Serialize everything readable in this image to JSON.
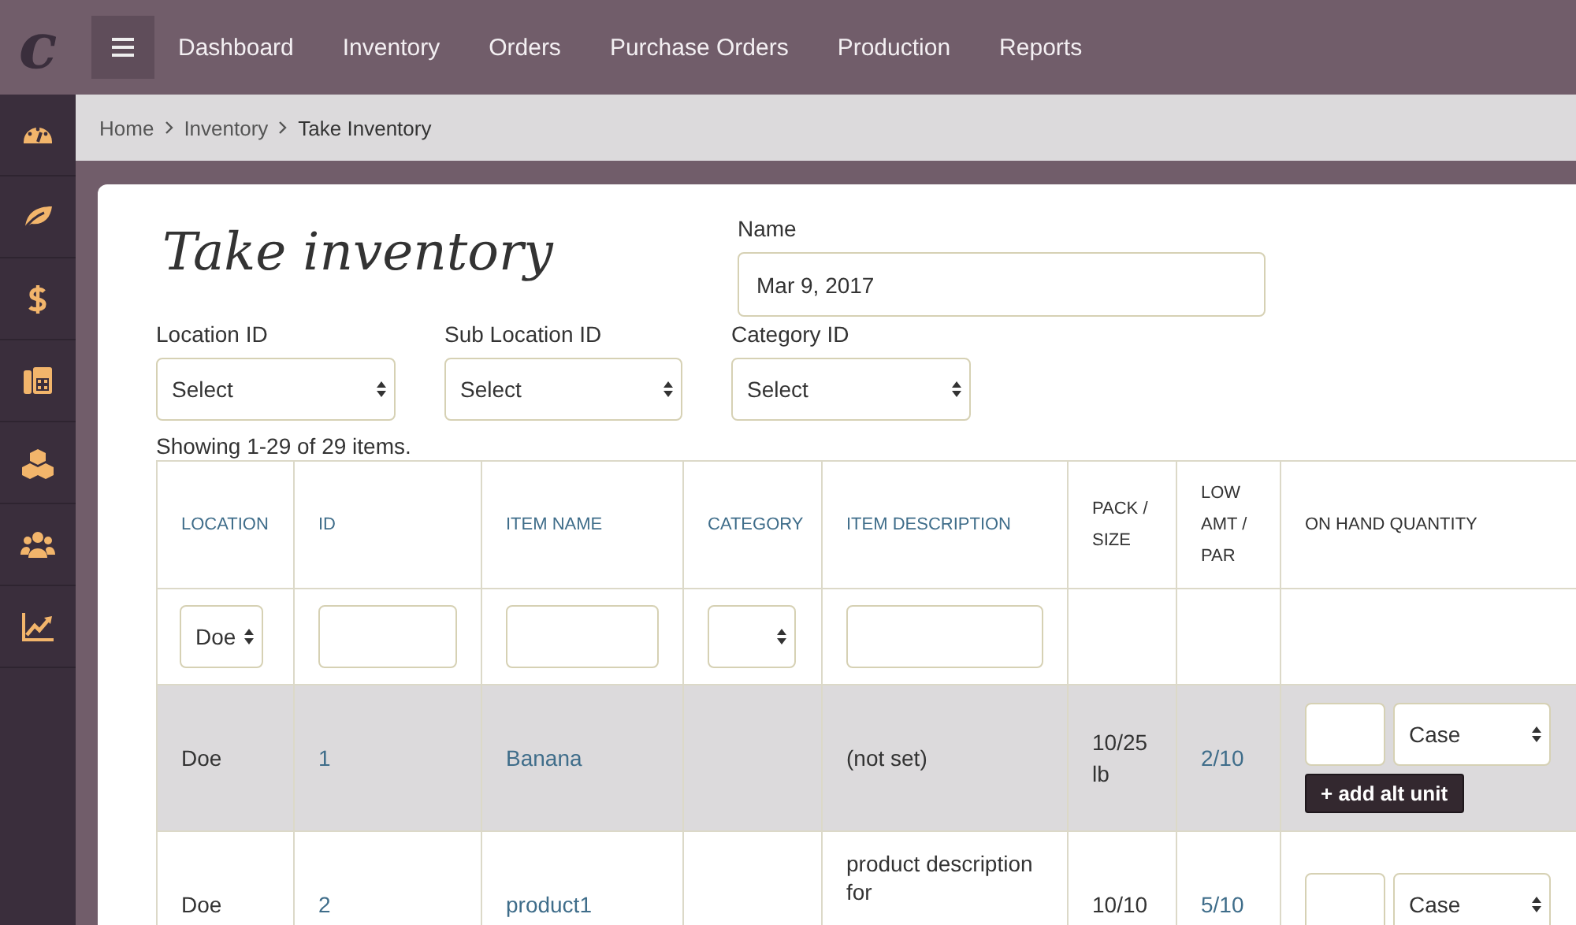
{
  "brand": {
    "logo": "c"
  },
  "nav": {
    "items": [
      {
        "label": "Dashboard"
      },
      {
        "label": "Inventory"
      },
      {
        "label": "Orders"
      },
      {
        "label": "Purchase Orders"
      },
      {
        "label": "Production"
      },
      {
        "label": "Reports"
      }
    ]
  },
  "sidebar": {
    "items": [
      {
        "kind": "gauge"
      },
      {
        "kind": "leaf"
      },
      {
        "kind": "dollar"
      },
      {
        "kind": "fax"
      },
      {
        "kind": "cubes"
      },
      {
        "kind": "users"
      },
      {
        "kind": "chart"
      }
    ]
  },
  "breadcrumb": [
    {
      "label": "Home",
      "kind": "link"
    },
    {
      "label": "Inventory",
      "kind": "link"
    },
    {
      "label": "Take Inventory",
      "kind": "current"
    }
  ],
  "page": {
    "title": "Take inventory",
    "name_field": {
      "label": "Name",
      "value": "Mar 9, 2017"
    },
    "filters": [
      {
        "label": "Location ID",
        "value": "Select"
      },
      {
        "label": "Sub Location ID",
        "value": "Select"
      },
      {
        "label": "Category ID",
        "value": "Select"
      }
    ],
    "summary": "Showing 1-29 of 29 items."
  },
  "table": {
    "columns": [
      {
        "label": "LOCATION",
        "sortable": true
      },
      {
        "label": "ID",
        "sortable": true
      },
      {
        "label": "ITEM NAME",
        "sortable": true
      },
      {
        "label": "CATEGORY",
        "sortable": true
      },
      {
        "label": "ITEM DESCRIPTION",
        "sortable": true
      },
      {
        "label": "PACK / SIZE",
        "sortable": false
      },
      {
        "label": "LOW AMT / PAR",
        "sortable": false
      },
      {
        "label": "ON HAND QUANTITY",
        "sortable": false
      }
    ],
    "filters": [
      {
        "kind": "select",
        "value": "Doe"
      },
      {
        "kind": "input"
      },
      {
        "kind": "input"
      },
      {
        "kind": "select"
      },
      {
        "kind": "input"
      },
      {
        "kind": "none"
      },
      {
        "kind": "none"
      },
      {
        "kind": "none"
      }
    ],
    "rows": [
      {
        "highlighted": true,
        "location": "Doe",
        "id": "1",
        "item_name": "Banana",
        "description": "(not set)",
        "pack_size": "10/25 lb",
        "low_par": "2/10",
        "unit": "Case",
        "add_unit_button": "+ add alt unit"
      },
      {
        "highlighted": false,
        "location": "Doe",
        "id": "2",
        "item_name": "product1",
        "description": "product description for",
        "pack_size": "10/10",
        "low_par": "5/10",
        "unit": "Case"
      }
    ]
  }
}
